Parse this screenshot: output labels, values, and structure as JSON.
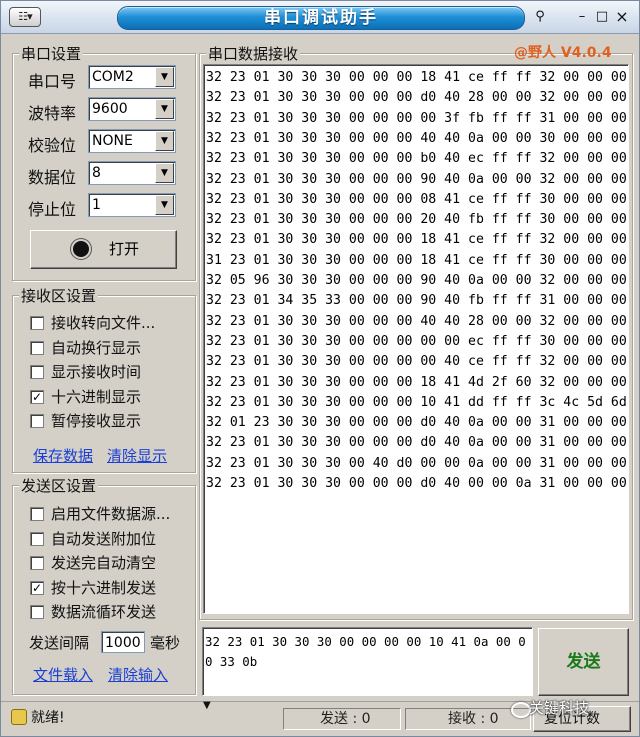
{
  "window": {
    "title": "串口调试助手",
    "sysmenu_glyph": "☷▾",
    "pin_glyph": "⚲",
    "minimize_glyph": "–",
    "maximize_glyph": "□",
    "close_glyph": "×"
  },
  "port_settings": {
    "title": "串口设置",
    "port": {
      "label": "串口号",
      "value": "COM2"
    },
    "baud": {
      "label": "波特率",
      "value": "9600"
    },
    "parity": {
      "label": "校验位",
      "value": "NONE"
    },
    "databits": {
      "label": "数据位",
      "value": "8"
    },
    "stopbits": {
      "label": "停止位",
      "value": "1"
    },
    "open_button": "打开"
  },
  "rx_settings": {
    "title": "接收区设置",
    "options": [
      {
        "label": "接收转向文件...",
        "checked": false
      },
      {
        "label": "自动换行显示",
        "checked": false
      },
      {
        "label": "显示接收时间",
        "checked": false
      },
      {
        "label": "十六进制显示",
        "checked": true
      },
      {
        "label": "暂停接收显示",
        "checked": false
      }
    ],
    "save_link": "保存数据",
    "clear_link": "清除显示"
  },
  "tx_settings": {
    "title": "发送区设置",
    "options": [
      {
        "label": "启用文件数据源...",
        "checked": false
      },
      {
        "label": "自动发送附加位",
        "checked": false
      },
      {
        "label": "发送完自动清空",
        "checked": false
      },
      {
        "label": "按十六进制发送",
        "checked": true
      },
      {
        "label": "数据流循环发送",
        "checked": false
      }
    ],
    "interval_label": "发送间隔",
    "interval_value": "1000",
    "interval_unit": "毫秒",
    "load_file_link": "文件载入",
    "clear_input_link": "清除输入"
  },
  "rx": {
    "title": "串口数据接收",
    "version": "@野人 V4.0.4",
    "lines": [
      "32 23 01 30 30 30 00 00 00 18 41 ce ff ff 32 00 00 00",
      "32 23 01 30 30 30 00 00 00 d0 40 28 00 00 32 00 00 00",
      "32 23 01 30 30 30 00 00 00 00 3f fb ff ff 31 00 00 00",
      "32 23 01 30 30 30 00 00 00 40 40 0a 00 00 30 00 00 00",
      "32 23 01 30 30 30 00 00 00 b0 40 ec ff ff 32 00 00 00",
      "32 23 01 30 30 30 00 00 00 90 40 0a 00 00 32 00 00 00",
      "32 23 01 30 30 30 00 00 00 08 41 ce ff ff 30 00 00 00",
      "32 23 01 30 30 30 00 00 00 20 40 fb ff ff 30 00 00 00",
      "32 23 01 30 30 30 00 00 00 18 41 ce ff ff 32 00 00 00",
      "31 23 01 30 30 30 00 00 00 18 41 ce ff ff 30 00 00 00",
      "32 05 96 30 30 30 00 00 00 90 40 0a 00 00 32 00 00 00",
      "32 23 01 34 35 33 00 00 00 90 40 fb ff ff 31 00 00 00",
      "32 23 01 30 30 30 00 00 00 40 40 28 00 00 32 00 00 00",
      "32 23 01 30 30 30 00 00 00 00 00 ec ff ff 30 00 00 00",
      "32 23 01 30 30 30 00 00 00 00 40 ce ff ff 32 00 00 00",
      "32 23 01 30 30 30 00 00 00 18 41 4d 2f 60 32 00 00 00",
      "32 23 01 30 30 30 00 00 00 10 41 dd ff ff 3c 4c 5d 6d",
      "32 01 23 30 30 30 00 00 00 d0 40 0a 00 00 31 00 00 00",
      "32 23 01 30 30 30 00 00 00 d0 40 0a 00 00 31 00 00 00",
      "32 23 01 30 30 30 00 40 d0 00 00 0a 00 00 31 00 00 00",
      "32 23 01 30 30 30 00 00 00 d0 40 00 00 0a 31 00 00 00"
    ]
  },
  "tx": {
    "text": "32 23 01 30 30 30 00 00 00 00 10 41 0a 00 00 33 0b",
    "send_button": "发送"
  },
  "status": {
    "ready": "就绪!",
    "sent": "发送 : 0",
    "received": "接收 : 0",
    "reset": "复位计数",
    "watermark": "关键科技"
  }
}
